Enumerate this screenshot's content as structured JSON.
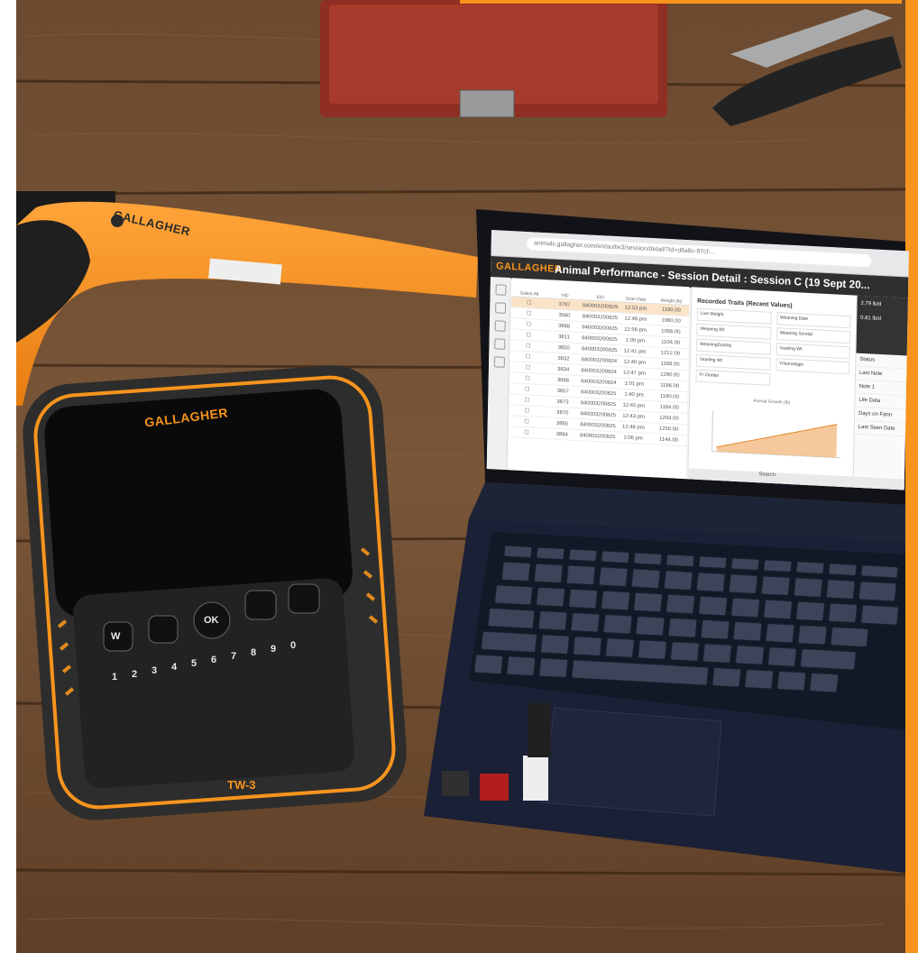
{
  "brand": {
    "wand_logo": "GALLAGHER",
    "device_logo": "GALLAGHER",
    "device_model": "TW-3",
    "accent_color": "#f7941d"
  },
  "laptop_screen": {
    "url": "animals.gallagher.com/en/au/tw3/session/detail/?id=d6a8c-97cf-...",
    "logo": "GALLAGHER",
    "title": "Animal Performance - Session Detail : Session C (19 Sept 20...",
    "table_headers": [
      "Select All",
      "VID",
      "EID",
      "Scan Date",
      "Weight (lb)"
    ],
    "rows": [
      [
        "3787",
        "840003200829442",
        "12:53 pm",
        "1180.00"
      ],
      [
        "3560",
        "840003200825099",
        "12:46 pm",
        "1060.00"
      ],
      [
        "3668",
        "840003200825100",
        "12:56 pm",
        "1056.00"
      ],
      [
        "3811",
        "840003200825100",
        "1:00 pm",
        "1104.00"
      ],
      [
        "3650",
        "840003200825099",
        "12:41 pm",
        "1212.00"
      ],
      [
        "3832",
        "840003200824987",
        "12:40 pm",
        "1168.00"
      ],
      [
        "3834",
        "840003200824987",
        "12:47 pm",
        "1290.00"
      ],
      [
        "3866",
        "840003200824985",
        "1:01 pm",
        "1186.00"
      ],
      [
        "3857",
        "840003200825021",
        "1:40 pm",
        "1180.00"
      ],
      [
        "3873",
        "840003200825017",
        "12:45 pm",
        "1164.00"
      ],
      [
        "3870",
        "840003200825020",
        "12:43 pm",
        "1204.00"
      ],
      [
        "3865",
        "840003200825025",
        "12:46 pm",
        "1250.00"
      ],
      [
        "3864",
        "840003200825026",
        "1:06 pm",
        "1144.00"
      ]
    ],
    "panel_title": "Recorded Traits (Recent Values)",
    "traits": [
      "Live Weight",
      "Weaning Date",
      "Weaning Wt",
      "Weaning Scrotal",
      "WeaningDocility",
      "Yearling Wt",
      "Yearling Wt",
      "Yrlsonologie",
      "Fr Clorlan"
    ],
    "chart_title": "Animal Growth (lb)",
    "side_values": [
      "2.79 lb/d",
      "0.81 lb/d",
      "Status",
      "Last Note",
      "Note 1",
      "Life Data",
      "Days on Farm",
      "Last Seen Date"
    ],
    "taskbar_search": "Search"
  },
  "device_keys": [
    "W",
    "OK",
    "1",
    "2",
    "3",
    "4",
    "5",
    "6",
    "7",
    "8",
    "9",
    "0"
  ]
}
